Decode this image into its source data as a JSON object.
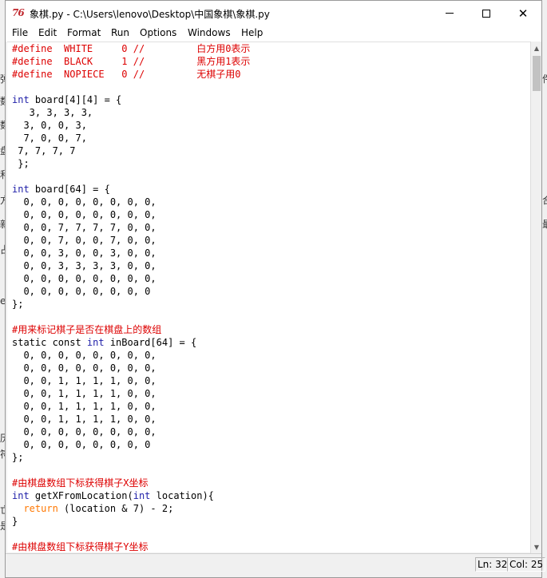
{
  "background_app": {
    "left_chars": [
      "弹",
      "数",
      "数",
      "盘",
      "和",
      "方",
      "新",
      "占",
      "er",
      "历",
      "符",
      "亡",
      "是"
    ],
    "right_chars": [
      "件",
      "合",
      "最"
    ]
  },
  "window": {
    "icon_label": "76",
    "title": "象棋.py - C:\\Users\\lenovo\\Desktop\\中国象棋\\象棋.py",
    "minimize_glyph": "—",
    "maximize_glyph": "☐",
    "close_glyph": "✕"
  },
  "menu": [
    "File",
    "Edit",
    "Format",
    "Run",
    "Options",
    "Windows",
    "Help"
  ],
  "code_lines": [
    [
      {
        "c": "cm",
        "t": "#define  WHITE     0 //         白方用0表示"
      }
    ],
    [
      {
        "c": "cm",
        "t": "#define  BLACK     1 //         黑方用1表示"
      }
    ],
    [
      {
        "c": "cm",
        "t": "#define  NOPIECE   0 //         无棋子用0"
      }
    ],
    [
      {
        "c": "",
        "t": ""
      }
    ],
    [
      {
        "c": "kb",
        "t": "int"
      },
      {
        "c": "",
        "t": " board[4][4] = {"
      }
    ],
    [
      {
        "c": "",
        "t": "   3, 3, 3, 3,"
      }
    ],
    [
      {
        "c": "",
        "t": "  3, 0, 0, 3,"
      }
    ],
    [
      {
        "c": "",
        "t": "  7, 0, 0, 7,"
      }
    ],
    [
      {
        "c": "",
        "t": " 7, 7, 7, 7"
      }
    ],
    [
      {
        "c": "",
        "t": " };"
      }
    ],
    [
      {
        "c": "",
        "t": ""
      }
    ],
    [
      {
        "c": "kb",
        "t": "int"
      },
      {
        "c": "",
        "t": " board[64] = {"
      }
    ],
    [
      {
        "c": "",
        "t": "  0, 0, 0, 0, 0, 0, 0, 0,"
      }
    ],
    [
      {
        "c": "",
        "t": "  0, 0, 0, 0, 0, 0, 0, 0,"
      }
    ],
    [
      {
        "c": "",
        "t": "  0, 0, 7, 7, 7, 7, 0, 0,"
      }
    ],
    [
      {
        "c": "",
        "t": "  0, 0, 7, 0, 0, 7, 0, 0,"
      }
    ],
    [
      {
        "c": "",
        "t": "  0, 0, 3, 0, 0, 3, 0, 0,"
      }
    ],
    [
      {
        "c": "",
        "t": "  0, 0, 3, 3, 3, 3, 0, 0,"
      }
    ],
    [
      {
        "c": "",
        "t": "  0, 0, 0, 0, 0, 0, 0, 0,"
      }
    ],
    [
      {
        "c": "",
        "t": "  0, 0, 0, 0, 0, 0, 0, 0"
      }
    ],
    [
      {
        "c": "",
        "t": "};"
      }
    ],
    [
      {
        "c": "",
        "t": ""
      }
    ],
    [
      {
        "c": "cm",
        "t": "#用来标记棋子是否在棋盘上的数组"
      }
    ],
    [
      {
        "c": "",
        "t": "static const "
      },
      {
        "c": "kb",
        "t": "int"
      },
      {
        "c": "",
        "t": " inBoard[64] = {"
      }
    ],
    [
      {
        "c": "",
        "t": "  0, 0, 0, 0, 0, 0, 0, 0,"
      }
    ],
    [
      {
        "c": "",
        "t": "  0, 0, 0, 0, 0, 0, 0, 0,"
      }
    ],
    [
      {
        "c": "",
        "t": "  0, 0, 1, 1, 1, 1, 0, 0,"
      }
    ],
    [
      {
        "c": "",
        "t": "  0, 0, 1, 1, 1, 1, 0, 0,"
      }
    ],
    [
      {
        "c": "",
        "t": "  0, 0, 1, 1, 1, 1, 0, 0,"
      }
    ],
    [
      {
        "c": "",
        "t": "  0, 0, 1, 1, 1, 1, 0, 0,"
      }
    ],
    [
      {
        "c": "",
        "t": "  0, 0, 0, 0, 0, 0, 0, 0,"
      }
    ],
    [
      {
        "c": "",
        "t": "  0, 0, 0, 0, 0, 0, 0, 0"
      }
    ],
    [
      {
        "c": "",
        "t": "};"
      }
    ],
    [
      {
        "c": "",
        "t": ""
      }
    ],
    [
      {
        "c": "cm",
        "t": "#由棋盘数组下标获得棋子X坐标"
      }
    ],
    [
      {
        "c": "kb",
        "t": "int"
      },
      {
        "c": "",
        "t": " getXFromLocation("
      },
      {
        "c": "kb",
        "t": "int"
      },
      {
        "c": "",
        "t": " location){"
      }
    ],
    [
      {
        "c": "",
        "t": "  "
      },
      {
        "c": "kw",
        "t": "return"
      },
      {
        "c": "",
        "t": " (location & 7) - 2;"
      }
    ],
    [
      {
        "c": "",
        "t": "}"
      }
    ],
    [
      {
        "c": "",
        "t": ""
      }
    ],
    [
      {
        "c": "cm",
        "t": "#由棋盘数组下标获得棋子Y坐标"
      }
    ]
  ],
  "status": {
    "line": "Ln: 32",
    "col": "Col: 25"
  },
  "colors": {
    "comment": "#dd0000",
    "keyword": "#ff7700",
    "builtin": "#1f1fa8",
    "icon": "#c0272d"
  }
}
